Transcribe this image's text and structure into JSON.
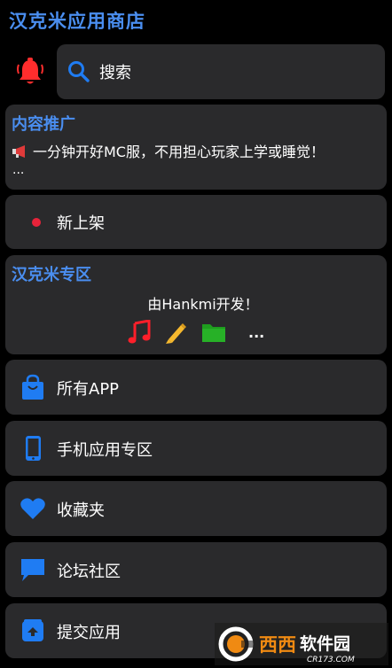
{
  "app": {
    "title": "汉克米应用商店"
  },
  "search": {
    "label": "搜索"
  },
  "promo": {
    "title": "内容推广",
    "text": "一分钟开好MC服，不用担心玩家上学或睡觉！",
    "more": "..."
  },
  "new_shelf": {
    "label": "新上架"
  },
  "zone": {
    "title": "汉克米专区",
    "subtitle": "由Hankmi开发！",
    "more": "...",
    "icons": [
      "music-note-icon",
      "pencil-icon",
      "folder-icon"
    ]
  },
  "menu": {
    "items": [
      {
        "label": "所有APP",
        "icon": "shopping-bag-icon"
      },
      {
        "label": "手机应用专区",
        "icon": "phone-icon"
      },
      {
        "label": "收藏夹",
        "icon": "heart-icon"
      },
      {
        "label": "论坛社区",
        "icon": "chat-bubble-icon"
      },
      {
        "label": "提交应用",
        "icon": "upload-box-icon"
      }
    ]
  },
  "watermark": {
    "brand": "西西软件园",
    "site": "CR173.COM"
  },
  "colors": {
    "accent": "#4a8ef0",
    "icon_blue": "#1f7cf3",
    "bell_red": "#ff2d2d",
    "dot_red": "#e8233a",
    "card_bg": "#2a2a2c",
    "music_red": "#ff1f2a",
    "pencil_yellow": "#f5b82e",
    "folder_green": "#1e9e1e"
  }
}
